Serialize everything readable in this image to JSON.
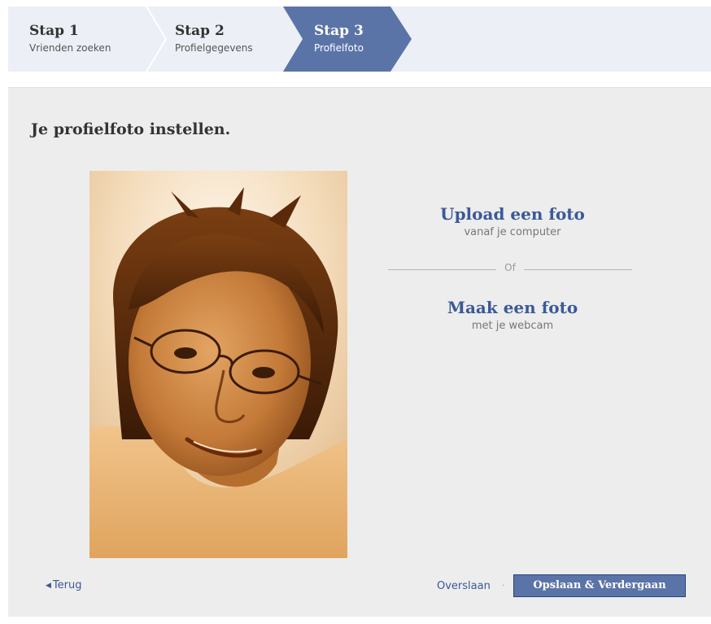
{
  "steps": [
    {
      "label": "Stap 1",
      "sub": "Vrienden zoeken"
    },
    {
      "label": "Stap 2",
      "sub": "Profielgegevens"
    },
    {
      "label": "Stap 3",
      "sub": "Profielfoto"
    }
  ],
  "page_title": "Je profielfoto instellen.",
  "options": {
    "upload": {
      "title": "Upload een foto",
      "hint": "vanaf je computer"
    },
    "divider_text": "Of",
    "webcam": {
      "title": "Maak een foto",
      "hint": "met je webcam"
    }
  },
  "footer": {
    "back_label": "Terug",
    "skip_label": "Overslaan",
    "save_label": "Opslaan & Verdergaan"
  },
  "colors": {
    "active_step": "#5b74a8",
    "link": "#3b5998",
    "panel_bg": "#ededed"
  },
  "icons": {
    "back": "triangle-left-icon",
    "separator": "chevron-separator"
  }
}
